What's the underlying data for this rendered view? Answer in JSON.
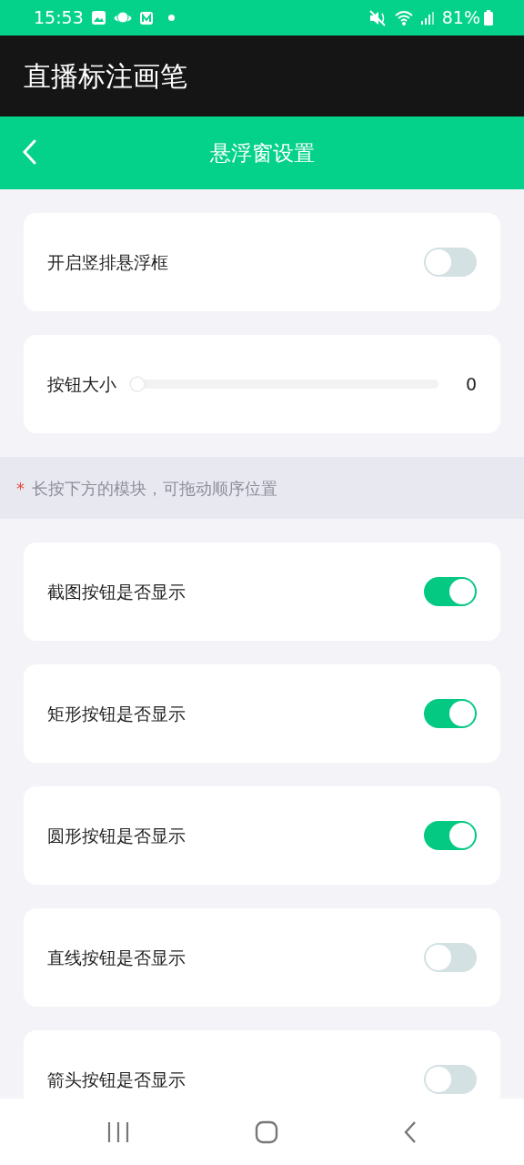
{
  "status_bar": {
    "time": "15:53",
    "battery": "81%"
  },
  "app_title": "直播标注画笔",
  "header": {
    "title": "悬浮窗设置"
  },
  "settings": [
    {
      "kind": "toggle",
      "label": "开启竖排悬浮框",
      "on": false
    },
    {
      "kind": "slider",
      "label": "按钮大小",
      "level": 0,
      "reading": "0"
    }
  ],
  "hint": {
    "mark": "*",
    "text": "长按下方的模块，可拖动顺序位置"
  },
  "modules": [
    {
      "label": "截图按钮是否显示",
      "on": true
    },
    {
      "label": "矩形按钮是否显示",
      "on": true
    },
    {
      "label": "圆形按钮是否显示",
      "on": true
    },
    {
      "label": "直线按钮是否显示",
      "on": false
    },
    {
      "label": "箭头按钮是否显示",
      "on": false
    }
  ]
}
